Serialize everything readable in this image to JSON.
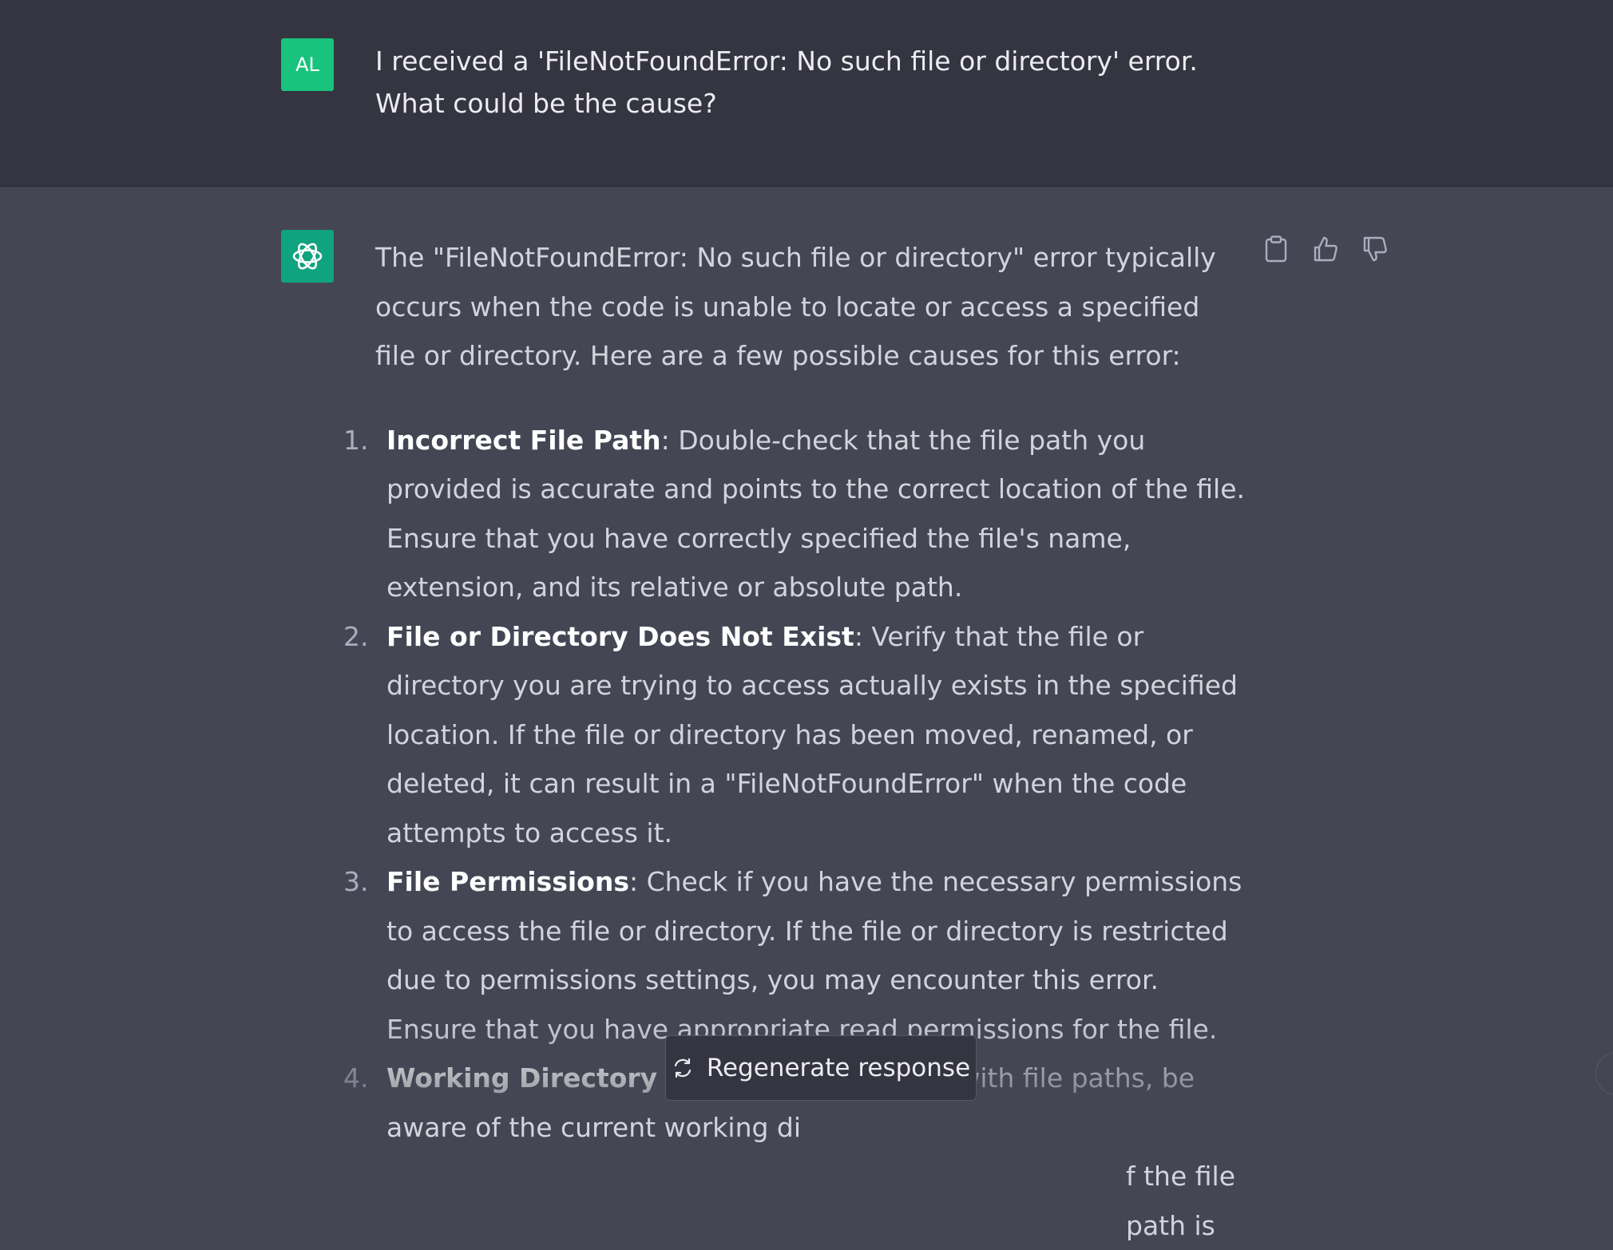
{
  "user_message": {
    "avatar_initials": "AL",
    "text": "I received a 'FileNotFoundError: No such file or directory' error. What could be the cause?"
  },
  "assistant_message": {
    "intro": "The \"FileNotFoundError: No such file or directory\" error typically occurs when the code is unable to locate or access a specified file or directory. Here are a few possible causes for this error:",
    "causes": [
      {
        "number": "1.",
        "title": "Incorrect File Path",
        "text": ": Double-check that the file path you provided is accurate and points to the correct location of the file. Ensure that you have correctly specified the file's name, extension, and its relative or absolute path."
      },
      {
        "number": "2.",
        "title": "File or Directory Does Not Exist",
        "text": ": Verify that the file or directory you are trying to access actually exists in the specified location. If the file or directory has been moved, renamed, or deleted, it can result in a \"FileNotFoundError\" when the code attempts to access it."
      },
      {
        "number": "3.",
        "title": "File Permissions",
        "text": ": Check if you have the necessary permissions to access the file or directory. If the file or directory is restricted due to permissions settings, you may encounter this error. Ensure that you have appropriate read permissions for the file."
      },
      {
        "number": "4.",
        "title": "Working Directory Issue",
        "text": ": When working with file paths, be aware of the current working di"
      },
      {
        "number": "",
        "title": "",
        "text": "f the file path is"
      }
    ]
  },
  "actions": {
    "copy_icon": "clipboard-icon",
    "like_icon": "thumbs-up-icon",
    "dislike_icon": "thumbs-down-icon"
  },
  "regenerate": {
    "label": "Regenerate response",
    "icon": "refresh-icon"
  },
  "colors": {
    "user_bg": "#343541",
    "assistant_bg": "#444654",
    "user_avatar": "#19c37d",
    "bot_avatar": "#10a37f"
  }
}
